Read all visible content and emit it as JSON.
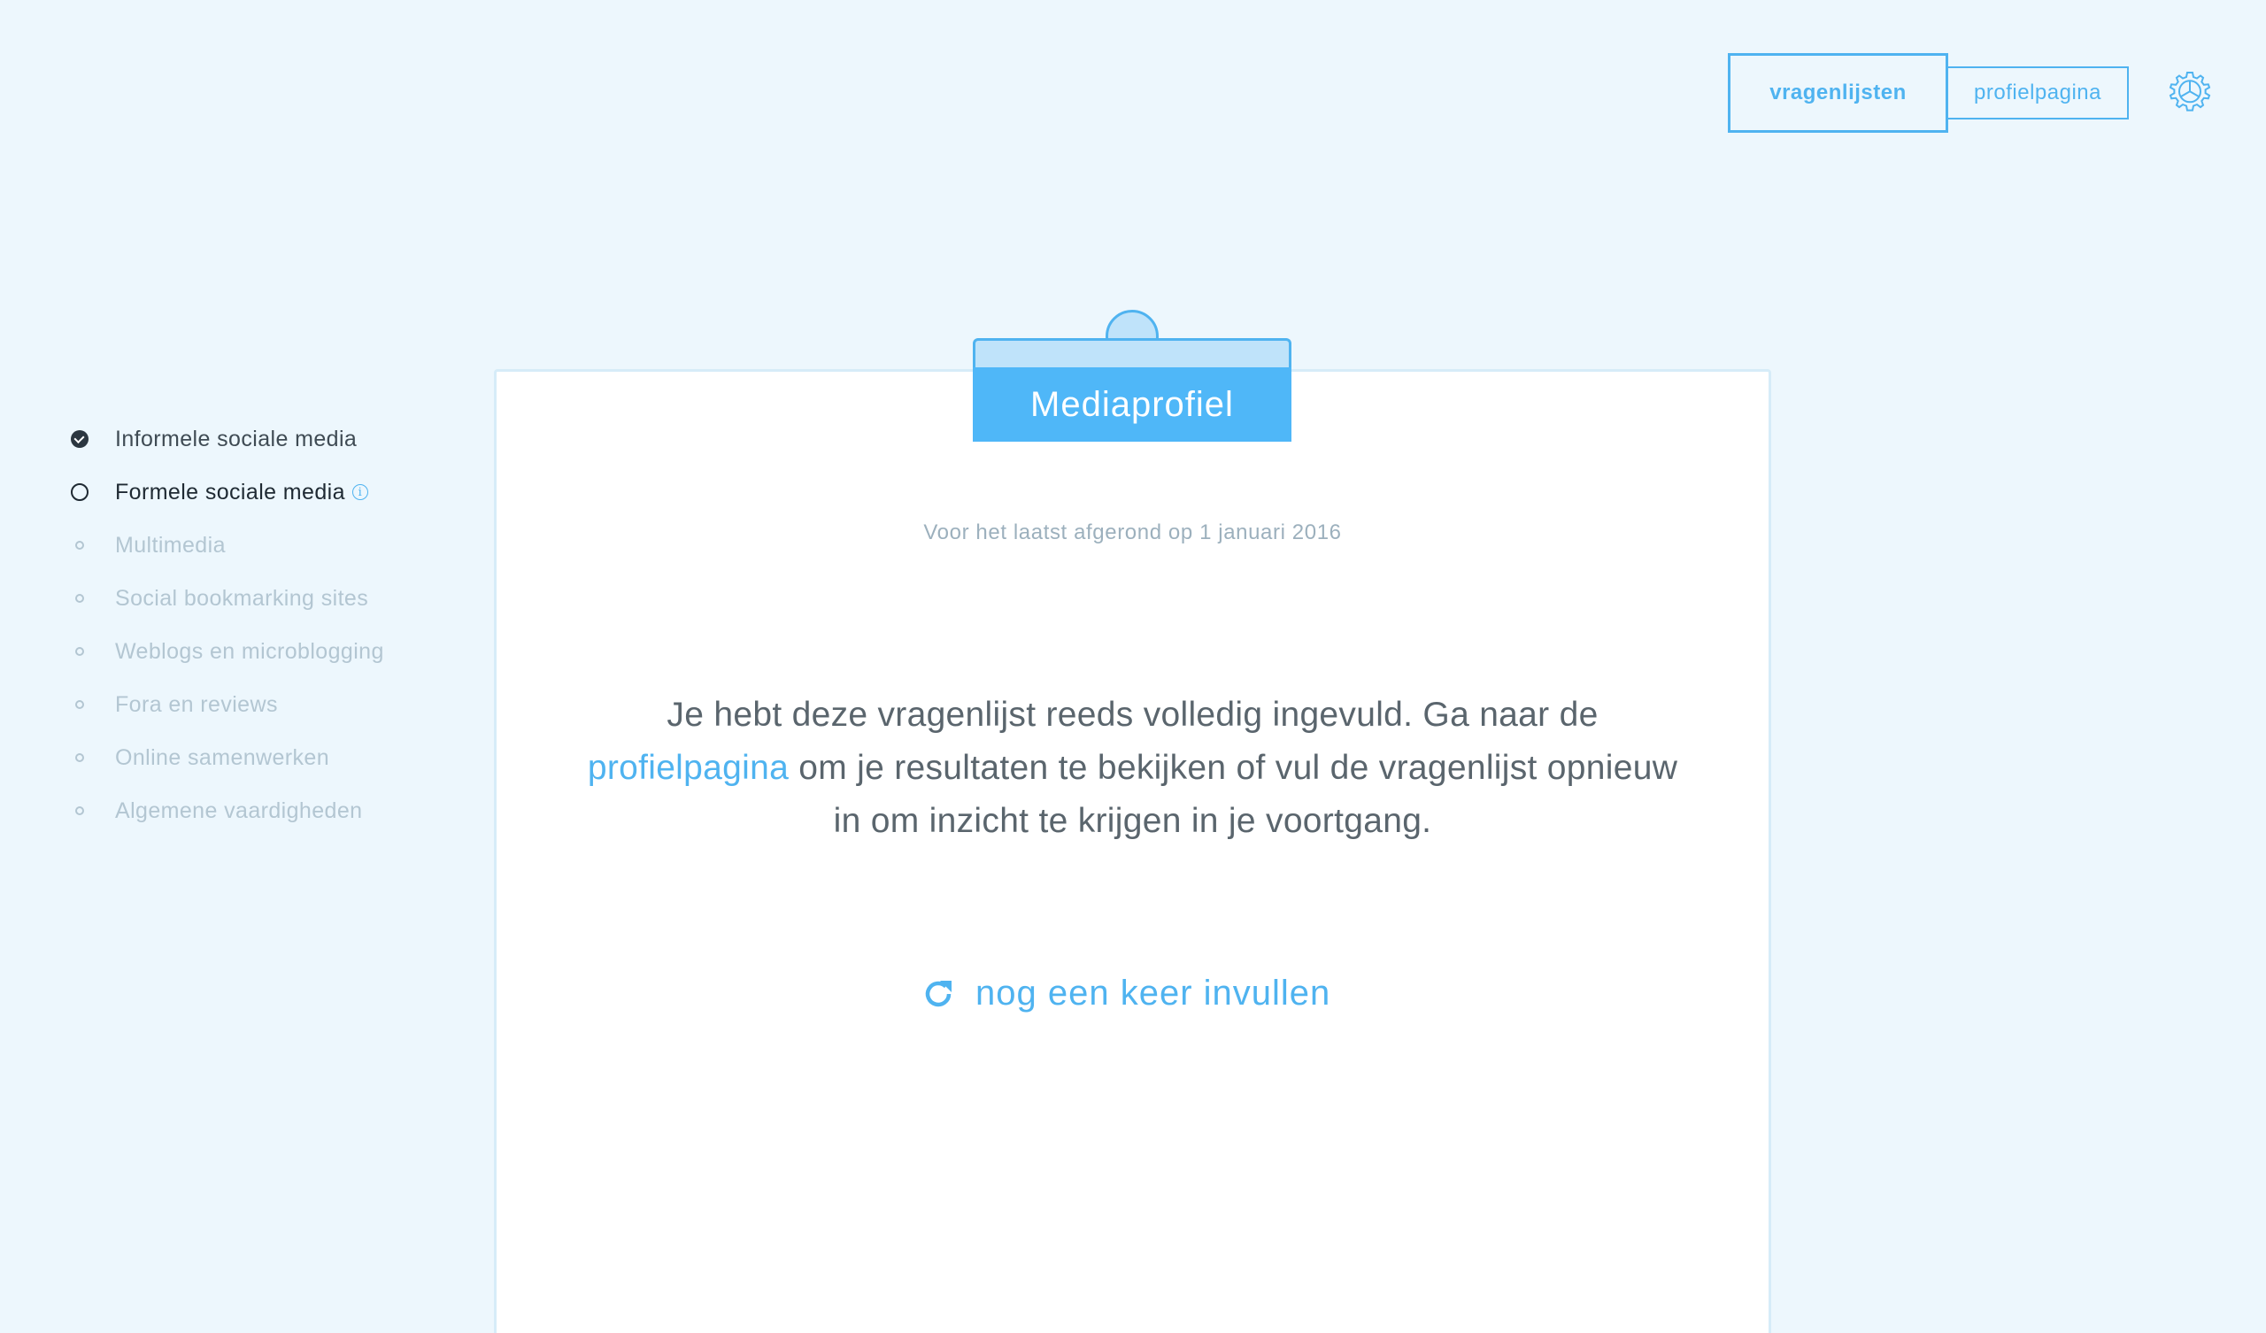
{
  "nav": {
    "questionnaires_label": "vragenlijsten",
    "profile_label": "profielpagina",
    "settings_icon": "gear-icon"
  },
  "sidebar": {
    "items": [
      {
        "label": "Informele sociale media",
        "status": "done"
      },
      {
        "label": "Formele sociale media",
        "status": "current",
        "info_icon": "info-icon"
      },
      {
        "label": "Multimedia",
        "status": "todo"
      },
      {
        "label": "Social bookmarking sites",
        "status": "todo"
      },
      {
        "label": "Weblogs en microblogging",
        "status": "todo"
      },
      {
        "label": "Fora en reviews",
        "status": "todo"
      },
      {
        "label": "Online samenwerken",
        "status": "todo"
      },
      {
        "label": "Algemene vaardigheden",
        "status": "todo"
      }
    ]
  },
  "card": {
    "tab_title": "Mediaprofiel",
    "last_completed": "Voor het laatst afgerond op 1 januari 2016",
    "message_part1": "Je hebt deze vragenlijst reeds volledig ingevuld. Ga naar de ",
    "message_link": "profielpagina",
    "message_part2": " om je resultaten te bekijken of vul de vragenlijst opnieuw in om inzicht te krijgen in je voortgang.",
    "redo_label": "nog een keer invullen",
    "redo_icon": "refresh-icon"
  },
  "colors": {
    "accent": "#4fb3f0",
    "background": "#edf7fd",
    "tab_fill": "#4fb7f8",
    "muted_text": "#b3c6d2"
  }
}
